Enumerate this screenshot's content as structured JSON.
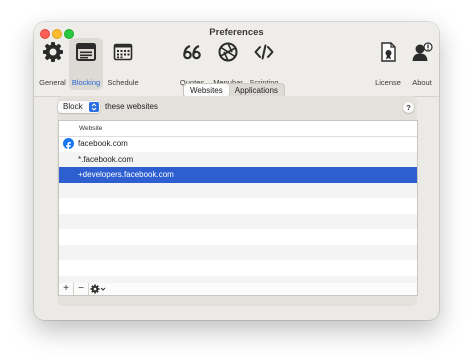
{
  "window": {
    "title": "Preferences"
  },
  "toolbar": {
    "items": [
      {
        "label": "General",
        "icon": "gear-icon"
      },
      {
        "label": "Blocking",
        "icon": "browser-window-icon",
        "active": true
      },
      {
        "label": "Schedule",
        "icon": "calendar-icon"
      },
      {
        "label": "Quotes",
        "icon": "quote-marks-icon"
      },
      {
        "label": "Menubar",
        "icon": "aperture-icon"
      },
      {
        "label": "Scripting",
        "icon": "code-brackets-icon"
      },
      {
        "label": "License",
        "icon": "certificate-icon"
      },
      {
        "label": "About",
        "icon": "person-icon"
      }
    ]
  },
  "segmented": {
    "tabs": [
      "Websites",
      "Applications"
    ],
    "selected": "Websites"
  },
  "rule": {
    "action": "Block",
    "suffix": "these websites"
  },
  "help": {
    "label": "?"
  },
  "table": {
    "header": "Website",
    "rows": [
      {
        "text": "facebook.com",
        "icon": "facebook-icon"
      },
      {
        "text": "*.facebook.com"
      },
      {
        "text": "+developers.facebook.com",
        "selected": true
      }
    ]
  },
  "bottombar": {
    "add": "+",
    "remove": "−",
    "gear_icon": "gear-icon",
    "chevron_icon": "chevron-down-icon"
  },
  "colors": {
    "accent": "#2e5fd1",
    "selected_tab_text": "#2866d1",
    "facebook": "#1877f2"
  }
}
